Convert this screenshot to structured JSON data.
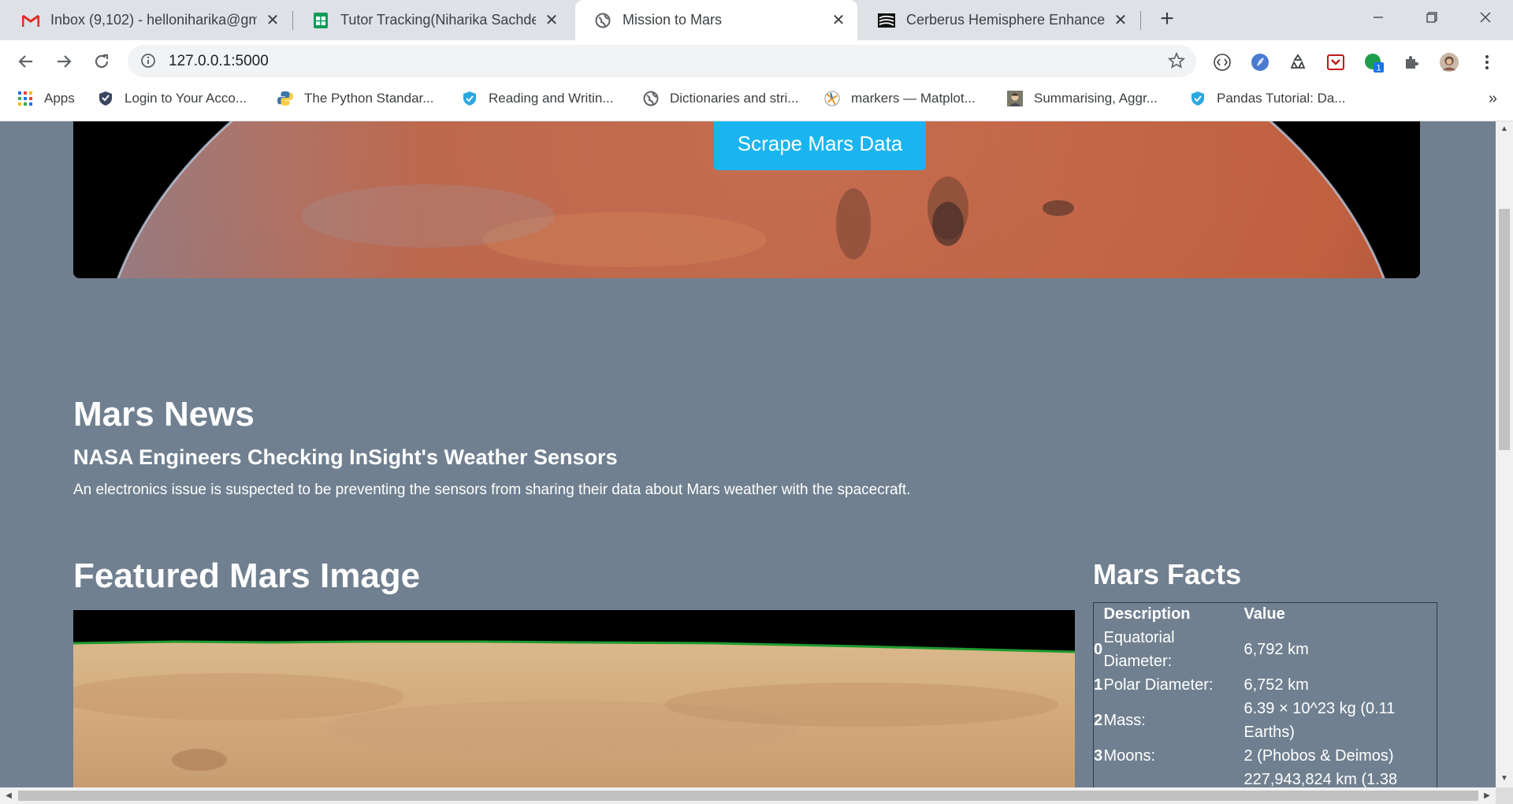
{
  "tabs": [
    {
      "title": "Inbox (9,102) - helloniharika@gm",
      "icon": "gmail-icon"
    },
    {
      "title": "Tutor Tracking(Niharika Sachdeva",
      "icon": "sheets-icon"
    },
    {
      "title": "Mission to Mars",
      "icon": "globe-icon"
    },
    {
      "title": "Cerberus Hemisphere Enhanced |",
      "icon": "usgs-icon"
    }
  ],
  "toolbar": {
    "url": "127.0.0.1:5000",
    "extension_badge": "1"
  },
  "bookmarks": [
    {
      "label": "Apps",
      "icon": "apps-grid-icon"
    },
    {
      "label": "Login to Your Acco...",
      "icon": "shield-check-icon"
    },
    {
      "label": "The Python Standar...",
      "icon": "python-icon"
    },
    {
      "label": "Reading and Writin...",
      "icon": "blue-shield-icon"
    },
    {
      "label": "Dictionaries and stri...",
      "icon": "globe-icon"
    },
    {
      "label": "markers — Matplot...",
      "icon": "matplotlib-icon"
    },
    {
      "label": "Summarising, Aggr...",
      "icon": "portrait-icon"
    },
    {
      "label": "Pandas Tutorial: Da...",
      "icon": "blue-shield-icon"
    }
  ],
  "bookmarks_more": "»",
  "page": {
    "scrape_button": "Scrape Mars Data",
    "news_heading": "Mars News",
    "news_title": "NASA Engineers Checking InSight's Weather Sensors",
    "news_paragraph": "An electronics issue is suspected to be preventing the sensors from sharing their data about Mars weather with the spacecraft.",
    "featured_heading": "Featured Mars Image",
    "facts_heading": "Mars Facts",
    "facts_columns": [
      "Description",
      "Value"
    ],
    "facts_rows": [
      {
        "index": "0",
        "description": "Equatorial Diameter:",
        "value": "6,792 km"
      },
      {
        "index": "1",
        "description": "Polar Diameter:",
        "value": "6,752 km"
      },
      {
        "index": "2",
        "description": "Mass:",
        "value": "6.39 × 10^23 kg (0.11 Earths)"
      },
      {
        "index": "3",
        "description": "Moons:",
        "value": "2 (Phobos & Deimos)"
      },
      {
        "index": "",
        "description": "",
        "value": "227,943,824 km (1.38"
      }
    ]
  },
  "colors": {
    "page_background": "#708090",
    "button_accent": "#1ab5f0"
  }
}
